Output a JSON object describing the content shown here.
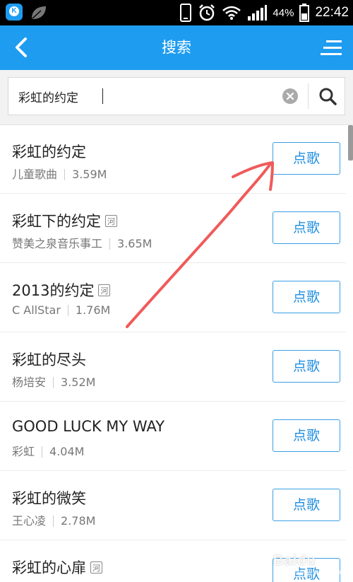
{
  "status_bar": {
    "battery_percent": "44%",
    "time": "22:42",
    "icons": [
      "k-app-icon",
      "leaf-icon",
      "phone-icon",
      "alarm-icon",
      "wifi-icon",
      "signal-icon",
      "battery-icon"
    ]
  },
  "header": {
    "title": "搜索",
    "back_icon": "chevron-left-icon",
    "menu_icon": "menu-icon"
  },
  "search": {
    "value": "彩虹的约定",
    "clear_icon": "clear-icon",
    "search_icon": "search-icon"
  },
  "results": [
    {
      "title": "彩虹的约定",
      "artist": "儿童歌曲",
      "size": "3.59M",
      "tag": "",
      "button": "点歌"
    },
    {
      "title": "彩虹下的约定",
      "artist": "赞美之泉音乐事工",
      "size": "3.65M",
      "tag": "河",
      "button": "点歌"
    },
    {
      "title": "2013的约定",
      "artist": "C AllStar",
      "size": "1.76M",
      "tag": "河",
      "button": "点歌"
    },
    {
      "title": "彩虹的尽头",
      "artist": "杨培安",
      "size": "3.52M",
      "tag": "",
      "button": "点歌"
    },
    {
      "title": "GOOD LUCK MY WAY",
      "artist": "彩虹",
      "size": "4.04M",
      "tag": "",
      "button": "点歌"
    },
    {
      "title": "彩虹的微笑",
      "artist": "王心凌",
      "size": "2.78M",
      "tag": "",
      "button": "点歌"
    },
    {
      "title": "彩虹的心扉",
      "artist": "",
      "size": "",
      "tag": "河",
      "button": "点歌"
    }
  ],
  "watermark": {
    "text": "Baidu",
    "sub": "jingyan.baidu.com"
  },
  "colors": {
    "accent": "#1e9cf0",
    "button_text": "#1e8ee0",
    "annotation": "#f05a5a"
  }
}
